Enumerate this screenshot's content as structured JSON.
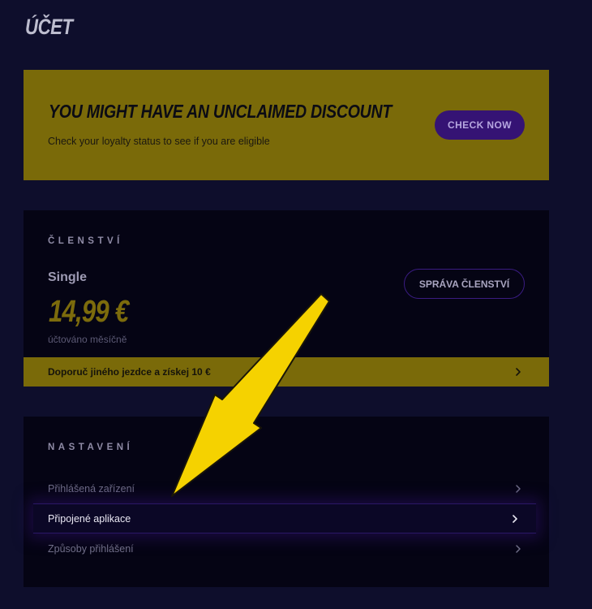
{
  "page": {
    "title": "ÚČET"
  },
  "promo": {
    "headline": "YOU MIGHT HAVE AN UNCLAIMED DISCOUNT",
    "subtext": "Check your loyalty status to see if you are eligible",
    "button_label": "CHECK NOW"
  },
  "membership": {
    "section_label": "ČLENSTVÍ",
    "plan_name": "Single",
    "price": "14,99 €",
    "billing_note": "účtováno měsíčně",
    "manage_button_label": "SPRÁVA ČLENSTVÍ",
    "referral_text": "Doporuč jiného jezdce a získej 10 €"
  },
  "settings": {
    "section_label": "NASTAVENÍ",
    "items": [
      {
        "label": "Přihlášená zařízení",
        "active": false
      },
      {
        "label": "Připojené aplikace",
        "active": true
      },
      {
        "label": "Způsoby přihlášení",
        "active": false
      }
    ]
  },
  "colors": {
    "background": "#0e0e2c",
    "accent_yellow": "#7a6a09",
    "accent_purple": "#351374",
    "annotation_arrow": "#f5d200"
  },
  "icons": {
    "row_chevron": "chevron-right-icon",
    "annotation": "arrow-annotation-icon"
  }
}
